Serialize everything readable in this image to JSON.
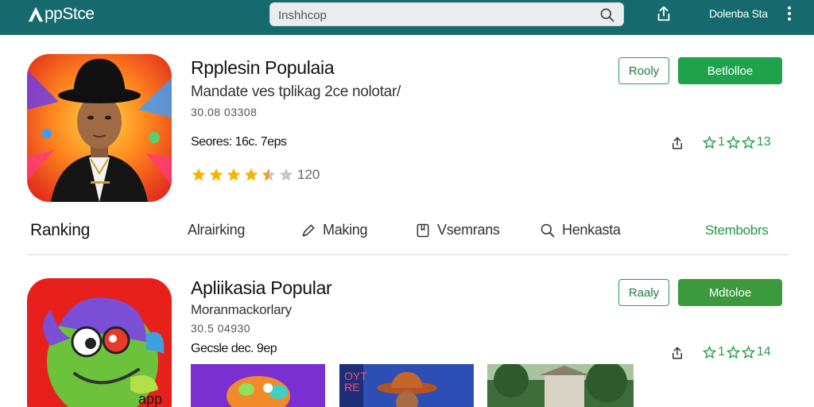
{
  "header": {
    "logo_letter": "A",
    "logo_text": "ppStce",
    "search_value": "Inshhcop",
    "account": "Dolenba Sta"
  },
  "apps": [
    {
      "title": "Rpplesin Populaia",
      "subtitle": "Mandate ves tplikag 2ce nolotar/",
      "meta": "30.08 03308",
      "detail": "Seores: 16c. 7eps",
      "btn_outline": "Rooly",
      "btn_solid": "Betlolloe",
      "rating_text": "13",
      "review_count": "120",
      "star_value": 4.5
    },
    {
      "title": "Apliikasia Popular",
      "subtitle": "Moranmackorlary",
      "meta": "30.5 04930",
      "detail": "Gecsle dec. 9ep",
      "btn_outline": "Raaly",
      "btn_solid": "Mdtoloe",
      "rating_text": "14",
      "badge_text": "app"
    }
  ],
  "ranking": {
    "title": "Ranking",
    "tabs": [
      {
        "label": "Alrairking",
        "icon": "none"
      },
      {
        "label": "Making",
        "icon": "pen-icon"
      },
      {
        "label": "Vsemrans",
        "icon": "bookmark-icon"
      },
      {
        "label": "Henkasta",
        "icon": "search-icon"
      }
    ],
    "link": "Stembobrs"
  },
  "thumb_text": "OYT RE",
  "colors": {
    "topbar": "#166a6e",
    "accent_green": "#1fa24b",
    "star": "#f5b400"
  }
}
